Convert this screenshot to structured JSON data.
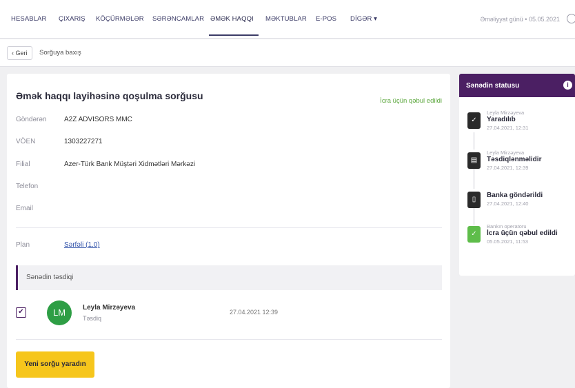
{
  "nav": {
    "items": [
      "HESABLAR",
      "ÇIXARIŞ",
      "KÖÇÜRMƏLƏR",
      "SƏRƏNCAMLAR",
      "ƏMƏK HAQQI",
      "MƏKTUBLAR",
      "E-POS",
      "DİGƏR ▾"
    ],
    "active_index": 4,
    "operational_day": "Əməliyyat günü • 05.05.2021"
  },
  "breadcrumb": {
    "back_label": "‹ Geri",
    "page_label": "Sorğuya baxış"
  },
  "request": {
    "title": "Əmək haqqı layihəsinə qoşulma sorğusu",
    "status": "İcra üçün qəbul edildi",
    "fields": [
      {
        "label": "Göndərən",
        "value": "A2Z ADVISORS MMC"
      },
      {
        "label": "VÖEN",
        "value": "1303227271"
      },
      {
        "label": "Filial",
        "value": "Azer-Türk Bank Müştəri Xidmətləri Mərkəzi"
      },
      {
        "label": "Telefon",
        "value": ""
      },
      {
        "label": "Email",
        "value": ""
      }
    ],
    "plan_label": "Plan",
    "plan_value": "Sərfəli (1.0)"
  },
  "approval": {
    "section_label": "Sənədin təsdiqi",
    "checkbox_mark": "✔",
    "avatar_initials": "LM",
    "avatar_color": "#2e9e45",
    "name": "Leyla Mirzəyeva",
    "role": "Təsdiq",
    "time": "27.04.2021 12:39"
  },
  "actions": {
    "new_request": "Yeni sorğu yaradın"
  },
  "doc_status": {
    "title": "Sənədin statusu",
    "info_glyph": "i",
    "steps": [
      {
        "user": "Leyla Mirzəyeva",
        "title": "Yaradılıb",
        "date": "27.04.2021, 12:31",
        "icon": "check-icon",
        "glyph": "✓",
        "done": false
      },
      {
        "user": "Leyla Mirzəyeva",
        "title": "Təsdiqlənməlidir",
        "date": "27.04.2021, 12:39",
        "icon": "document-icon",
        "glyph": "▤",
        "done": false
      },
      {
        "user": "",
        "title": "Banka göndərildi",
        "date": "27.04.2021, 12:40",
        "icon": "phone-icon",
        "glyph": "▯",
        "done": false
      },
      {
        "user": "Bankın operatoru",
        "title": "İcra üçün qəbul edildi",
        "date": "05.05.2021, 11:53",
        "icon": "check-icon",
        "glyph": "✓",
        "done": true
      }
    ]
  },
  "colors": {
    "accent_purple": "#4b1f63",
    "status_green": "#5aa63b",
    "button_yellow": "#f6c61c",
    "link_blue": "#2d4fa8"
  }
}
